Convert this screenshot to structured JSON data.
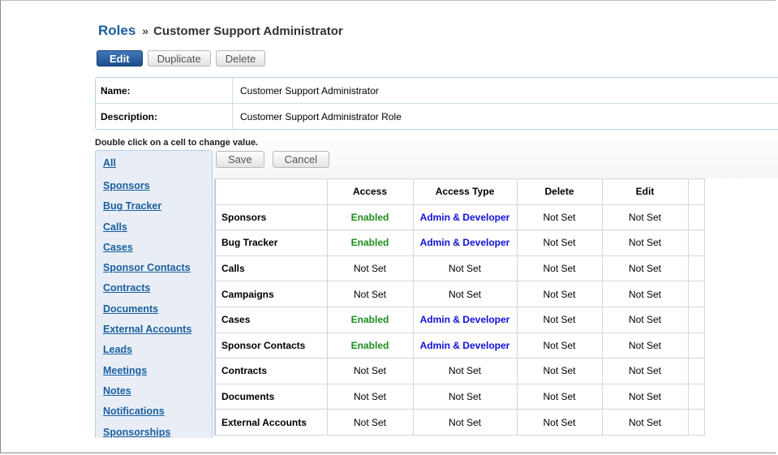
{
  "breadcrumb": {
    "root": "Roles",
    "separator": "»",
    "current": "Customer Support Administrator"
  },
  "toolbar": {
    "edit": "Edit",
    "duplicate": "Duplicate",
    "delete": "Delete"
  },
  "details": {
    "name_label": "Name:",
    "name_value": "Customer Support Administrator",
    "description_label": "Description:",
    "description_value": "Customer Support Administrator Role"
  },
  "hint": "Double click on a cell to change value.",
  "sidebar": {
    "items": [
      "All",
      "Sponsors",
      "Bug Tracker",
      "Calls",
      "Cases",
      "Sponsor Contacts",
      "Contracts",
      "Documents",
      "External Accounts",
      "Leads",
      "Meetings",
      "Notes",
      "Notifications",
      "Sponsorships"
    ]
  },
  "grid_actions": {
    "save": "Save",
    "cancel": "Cancel"
  },
  "grid": {
    "headers": [
      "",
      "Access",
      "Access Type",
      "Delete",
      "Edit"
    ],
    "rows": [
      [
        "Sponsors",
        "Enabled",
        "Admin & Developer",
        "Not Set",
        "Not Set"
      ],
      [
        "Bug Tracker",
        "Enabled",
        "Admin & Developer",
        "Not Set",
        "Not Set"
      ],
      [
        "Calls",
        "Not Set",
        "Not Set",
        "Not Set",
        "Not Set"
      ],
      [
        "Campaigns",
        "Not Set",
        "Not Set",
        "Not Set",
        "Not Set"
      ],
      [
        "Cases",
        "Enabled",
        "Admin & Developer",
        "Not Set",
        "Not Set"
      ],
      [
        "Sponsor Contacts",
        "Enabled",
        "Admin & Developer",
        "Not Set",
        "Not Set"
      ],
      [
        "Contracts",
        "Not Set",
        "Not Set",
        "Not Set",
        "Not Set"
      ],
      [
        "Documents",
        "Not Set",
        "Not Set",
        "Not Set",
        "Not Set"
      ],
      [
        "External Accounts",
        "Not Set",
        "Not Set",
        "Not Set",
        "Not Set"
      ]
    ]
  },
  "colors": {
    "link": "#1a5f9e",
    "enabled": "#1d8c1d",
    "admin_developer": "#1010d8",
    "primary_button": "#1d4f8e"
  }
}
